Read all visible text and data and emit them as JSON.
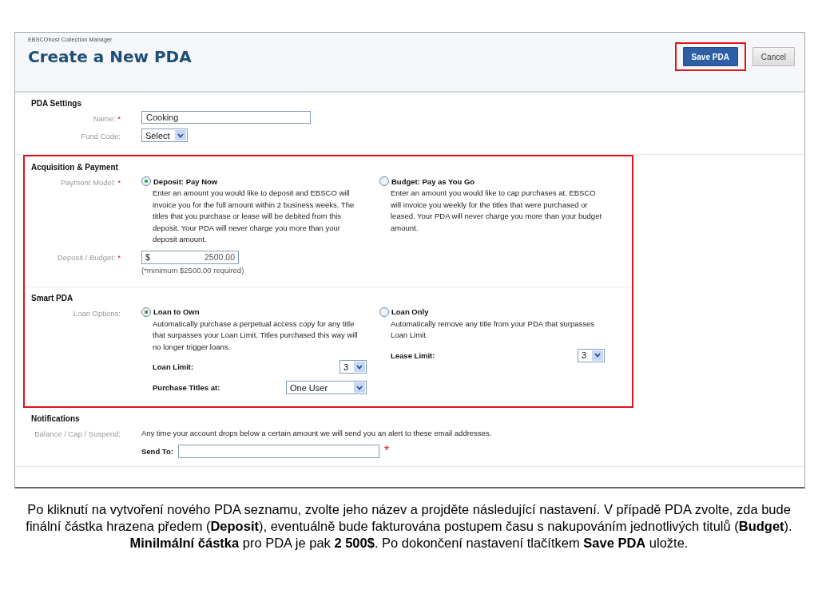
{
  "header": {
    "app_name": "EBSCOhost Collection Manager",
    "title": "Create a New PDA",
    "buttons": [
      {
        "label": "Save PDA",
        "kind": "primary",
        "highlighted": true
      },
      {
        "label": "Cancel",
        "kind": "secondary",
        "highlighted": false
      }
    ]
  },
  "sections": [
    {
      "title": "PDA Settings",
      "highlighted": false,
      "rows": [
        {
          "kind": "text",
          "label": "Name:",
          "required_mark": "*",
          "value": "Cooking"
        },
        {
          "kind": "select",
          "label": "Fund Code:",
          "value": "Select"
        }
      ]
    },
    {
      "title": "Acquisition & Payment",
      "highlighted": true,
      "rows": [
        {
          "kind": "options",
          "label": "Payment Model:",
          "required_mark": "*",
          "options": [
            {
              "title": "Deposit: Pay Now",
              "selected": true,
              "description": "Enter an amount you would like to deposit and EBSCO will invoice you for the full amount within 2 business weeks. The titles that you purchase or lease will be debited from this deposit. Your PDA will never charge you more than your deposit amount."
            },
            {
              "title": "Budget: Pay as You Go",
              "selected": false,
              "description": "Enter an amount you would like to cap purchases at. EBSCO will invoice you weekly for the titles that were purchased or leased. Your PDA will never charge you more than your budget amount."
            }
          ]
        },
        {
          "kind": "amount",
          "label": "Deposit / Budget:",
          "required_mark": "*",
          "currency": "$",
          "value": "2500.00",
          "note": "(*minimum $2500.00 required)"
        }
      ]
    },
    {
      "title": "Smart PDA",
      "highlighted": true,
      "rows": [
        {
          "kind": "options",
          "label": "Loan Options:",
          "options": [
            {
              "title": "Loan to Own",
              "selected": true,
              "description": "Automatically purchase a perpetual access copy for any title that surpasses your Loan Limit. Titles purchased this way will no longer trigger loans.",
              "controls": [
                {
                  "label": "Loan Limit:",
                  "value": "3",
                  "kind": "narrow"
                },
                {
                  "label": "Purchase Titles at:",
                  "value": "One User",
                  "kind": "wide"
                }
              ]
            },
            {
              "title": "Loan Only",
              "selected": false,
              "description": "Automatically remove any title from your PDA that surpasses Loan Limit.",
              "controls": [
                {
                  "label": "Lease Limit:",
                  "value": "3",
                  "kind": "narrow"
                }
              ]
            }
          ]
        }
      ]
    },
    {
      "title": "Notifications",
      "highlighted": false,
      "rows": [
        {
          "kind": "info",
          "label": "Balance / Cap / Suspend:",
          "text": "Any time your account drops below a certain amount we will send you an alert to these email addresses."
        },
        {
          "kind": "send-to",
          "field_label": "Send To:",
          "required_mark": "*"
        }
      ]
    }
  ],
  "caption": "Po kliknutí na vytvoření nového PDA seznamu, zvolte jeho název a projděte následující nastavení. V případě PDA zvolte, zda bude finální částka hrazena předem (**Deposit**), eventuálně bude fakturována postupem času s nakupováním jednotlivých titulů (**Budget**). **Minilmální částka** pro PDA je pak **2 500$**. Po dokončení nastavení tlačítkem **Save PDA** uložte."
}
